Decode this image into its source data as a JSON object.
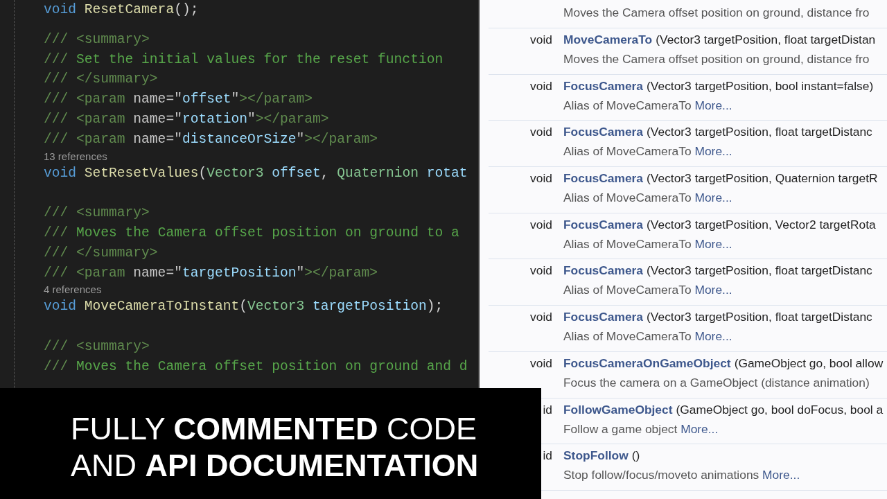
{
  "code_editor": {
    "lines": [
      {
        "kind": "code",
        "tokens": [
          {
            "kind": "keyword",
            "text": "void "
          },
          {
            "kind": "method",
            "text": "ResetCamera"
          },
          {
            "kind": "plain",
            "text": "();"
          }
        ]
      },
      {
        "kind": "blank"
      },
      {
        "kind": "code",
        "tokens": [
          {
            "kind": "doc",
            "text": "/// <summary>"
          }
        ]
      },
      {
        "kind": "code",
        "tokens": [
          {
            "kind": "doc",
            "text": "/// "
          },
          {
            "kind": "comment",
            "text": "Set the initial values for the reset function"
          }
        ]
      },
      {
        "kind": "code",
        "tokens": [
          {
            "kind": "doc",
            "text": "/// </summary>"
          }
        ]
      },
      {
        "kind": "code",
        "tokens": [
          {
            "kind": "doc",
            "text": "/// <param "
          },
          {
            "kind": "attr",
            "text": "name=\""
          },
          {
            "kind": "string",
            "text": "offset"
          },
          {
            "kind": "attr",
            "text": "\""
          },
          {
            "kind": "doc",
            "text": "></param>"
          }
        ]
      },
      {
        "kind": "code",
        "tokens": [
          {
            "kind": "doc",
            "text": "/// <param "
          },
          {
            "kind": "attr",
            "text": "name=\""
          },
          {
            "kind": "string",
            "text": "rotation"
          },
          {
            "kind": "attr",
            "text": "\""
          },
          {
            "kind": "doc",
            "text": "></param>"
          }
        ]
      },
      {
        "kind": "code",
        "tokens": [
          {
            "kind": "doc",
            "text": "/// <param "
          },
          {
            "kind": "attr",
            "text": "name=\""
          },
          {
            "kind": "string",
            "text": "distanceOrSize"
          },
          {
            "kind": "attr",
            "text": "\""
          },
          {
            "kind": "doc",
            "text": "></param>"
          }
        ]
      },
      {
        "kind": "refs",
        "text": "13 references"
      },
      {
        "kind": "code",
        "tokens": [
          {
            "kind": "keyword",
            "text": "void "
          },
          {
            "kind": "method",
            "text": "SetResetValues"
          },
          {
            "kind": "plain",
            "text": "("
          },
          {
            "kind": "type",
            "text": "Vector3 "
          },
          {
            "kind": "param",
            "text": "offset"
          },
          {
            "kind": "plain",
            "text": ", "
          },
          {
            "kind": "type",
            "text": "Quaternion "
          },
          {
            "kind": "param",
            "text": "rotat"
          }
        ]
      },
      {
        "kind": "blank"
      },
      {
        "kind": "code",
        "tokens": [
          {
            "kind": "doc",
            "text": "/// <summary>"
          }
        ]
      },
      {
        "kind": "code",
        "tokens": [
          {
            "kind": "doc",
            "text": "/// "
          },
          {
            "kind": "comment",
            "text": "Moves the Camera offset position on ground to a"
          }
        ]
      },
      {
        "kind": "code",
        "tokens": [
          {
            "kind": "doc",
            "text": "/// </summary>"
          }
        ]
      },
      {
        "kind": "code",
        "tokens": [
          {
            "kind": "doc",
            "text": "/// <param "
          },
          {
            "kind": "attr",
            "text": "name=\""
          },
          {
            "kind": "string",
            "text": "targetPosition"
          },
          {
            "kind": "attr",
            "text": "\""
          },
          {
            "kind": "doc",
            "text": "></param>"
          }
        ]
      },
      {
        "kind": "refs",
        "text": "4 references"
      },
      {
        "kind": "code",
        "tokens": [
          {
            "kind": "keyword",
            "text": "void "
          },
          {
            "kind": "method",
            "text": "MoveCameraToInstant"
          },
          {
            "kind": "plain",
            "text": "("
          },
          {
            "kind": "type",
            "text": "Vector3 "
          },
          {
            "kind": "param",
            "text": "targetPosition"
          },
          {
            "kind": "plain",
            "text": ");"
          }
        ]
      },
      {
        "kind": "blank"
      },
      {
        "kind": "code",
        "tokens": [
          {
            "kind": "doc",
            "text": "/// <summary>"
          }
        ]
      },
      {
        "kind": "code",
        "tokens": [
          {
            "kind": "doc",
            "text": "/// "
          },
          {
            "kind": "comment",
            "text": "Moves the Camera offset position on ground and d"
          }
        ]
      }
    ]
  },
  "api_docs": {
    "members": [
      {
        "description": "Moves the Camera offset position on ground, distance fro"
      },
      {
        "type": "void",
        "name": "MoveCameraTo",
        "params": "(Vector3 targetPosition, float targetDistan",
        "description": "Moves the Camera offset position on ground, distance fro"
      },
      {
        "type": "void",
        "name": "FocusCamera",
        "params": "(Vector3 targetPosition, bool instant=false)",
        "description": "Alias of MoveCameraTo",
        "more": "More..."
      },
      {
        "type": "void",
        "name": "FocusCamera",
        "params": "(Vector3 targetPosition, float targetDistanc",
        "description": "Alias of MoveCameraTo",
        "more": "More..."
      },
      {
        "type": "void",
        "name": "FocusCamera",
        "params": "(Vector3 targetPosition, Quaternion targetR",
        "description": "Alias of MoveCameraTo",
        "more": "More..."
      },
      {
        "type": "void",
        "name": "FocusCamera",
        "params": "(Vector3 targetPosition, Vector2 targetRota",
        "description": "Alias of MoveCameraTo",
        "more": "More..."
      },
      {
        "type": "void",
        "name": "FocusCamera",
        "params": "(Vector3 targetPosition, float targetDistanc",
        "description": "Alias of MoveCameraTo",
        "more": "More..."
      },
      {
        "type": "void",
        "name": "FocusCamera",
        "params": "(Vector3 targetPosition, float targetDistanc",
        "description": "Alias of MoveCameraTo",
        "more": "More..."
      },
      {
        "type": "void",
        "name": "FocusCameraOnGameObject",
        "params": "(GameObject go, bool allow",
        "description": "Focus the camera on a GameObject (distance animation)"
      },
      {
        "type": "id",
        "name": "FollowGameObject",
        "params": "(GameObject go, bool doFocus, bool a",
        "description": "Follow a game object",
        "more": "More..."
      },
      {
        "type": "id",
        "name": "StopFollow",
        "params": "()",
        "description": "Stop follow/focus/moveto animations",
        "more": "More..."
      }
    ]
  },
  "banner": {
    "lines": [
      "FULLY **COMMENTED** CODE",
      "AND **API DOCUMENTATION**"
    ]
  }
}
